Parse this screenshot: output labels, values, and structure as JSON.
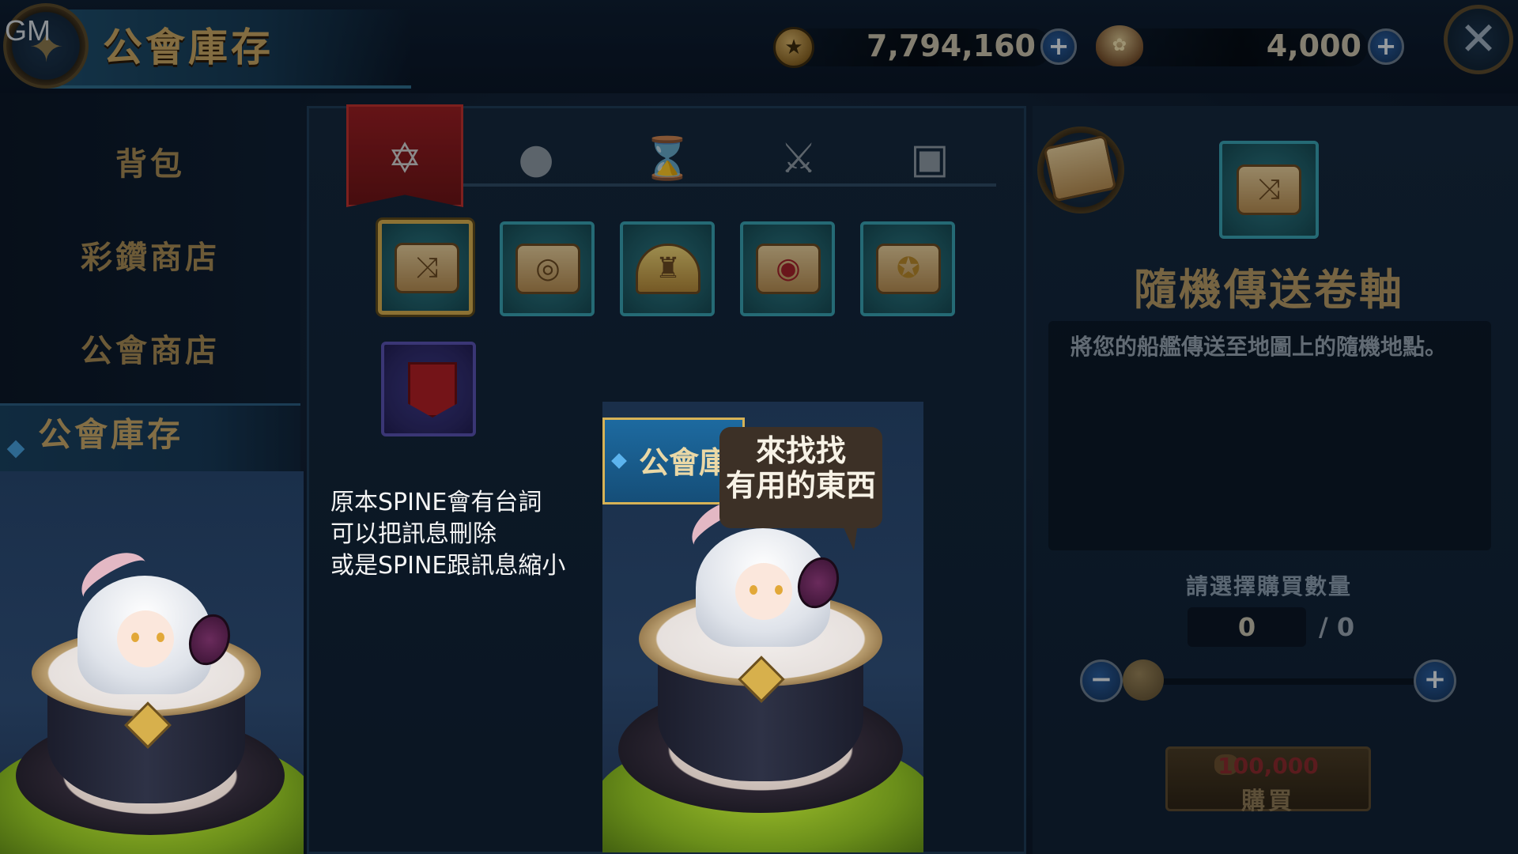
{
  "header": {
    "title": "公會庫存",
    "gm_label": "GM",
    "currencies": [
      {
        "name": "gold-coin",
        "value": "7,794,160"
      },
      {
        "name": "guild-bag",
        "value": "4,000"
      }
    ]
  },
  "sidebar": {
    "items": [
      {
        "label": "背包",
        "active": false
      },
      {
        "label": "彩鑽商店",
        "active": false
      },
      {
        "label": "公會商店",
        "active": false
      },
      {
        "label": "公會庫存",
        "active": true
      }
    ]
  },
  "tabs": [
    {
      "icon": "hexagram-icon",
      "active": true
    },
    {
      "icon": "pouch-icon",
      "active": false
    },
    {
      "icon": "hourglass-icon",
      "active": false
    },
    {
      "icon": "crossed-swords-icon",
      "active": false
    },
    {
      "icon": "chest-icon",
      "active": false
    }
  ],
  "items": [
    {
      "icon": "random-teleport-scroll-icon",
      "selected": true
    },
    {
      "icon": "target-scroll-icon",
      "selected": false
    },
    {
      "icon": "portal-tower-icon",
      "selected": false
    },
    {
      "icon": "red-target-scroll-icon",
      "selected": false
    },
    {
      "icon": "gold-target-scroll-icon",
      "selected": false
    },
    {
      "icon": "red-banner-icon",
      "selected": false
    }
  ],
  "detail": {
    "name": "隨機傳送卷軸",
    "description": "將您的船艦傳送至地圖上的隨機地點。",
    "quantity_label": "請選擇購買數量",
    "quantity": "0",
    "max_quantity": "/ 0",
    "buy_price": "100,000",
    "buy_label": "購買"
  },
  "annotation": {
    "lines": [
      "原本SPINE會有台詞",
      "可以把訊息刪除",
      "或是SPINE跟訊息縮小"
    ]
  },
  "insert": {
    "header_text": "公會庫",
    "speech_lines": [
      "來找找",
      "有用的東西"
    ]
  },
  "colors": {
    "accent_gold": "#c8a765",
    "tab_active_red": "#9b1f24",
    "slot_teal": "#2e7f8a",
    "price_red": "#8b2a2e"
  }
}
